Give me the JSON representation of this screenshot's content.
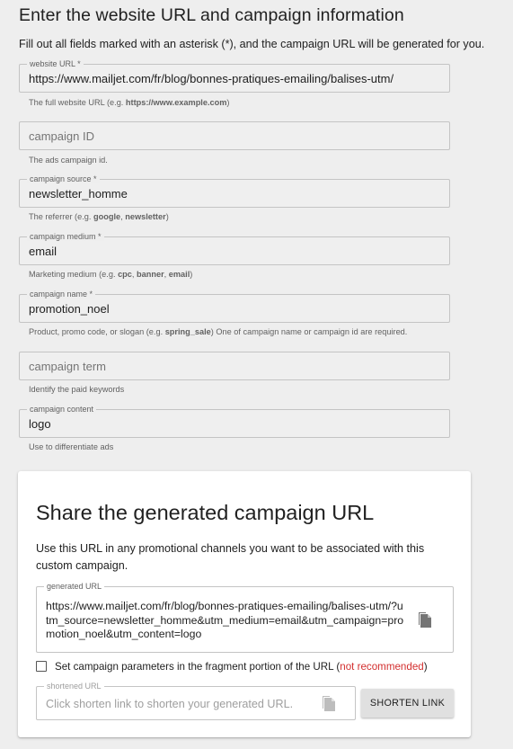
{
  "heading": "Enter the website URL and campaign information",
  "intro": "Fill out all fields marked with an asterisk (*), and the campaign URL will be generated for you.",
  "fields": {
    "website_url": {
      "label": "website URL *",
      "value": "https://www.mailjet.com/fr/blog/bonnes-pratiques-emailing/balises-utm/",
      "helper_pre": "The full website URL (e.g. ",
      "helper_bold": "https://www.example.com",
      "helper_post": ")"
    },
    "campaign_id": {
      "placeholder": "campaign ID",
      "helper": "The ads campaign id."
    },
    "campaign_source": {
      "label": "campaign source *",
      "value": "newsletter_homme",
      "helper_pre": "The referrer (e.g. ",
      "helper_b1": "google",
      "helper_sep": ", ",
      "helper_b2": "newsletter",
      "helper_post": ")"
    },
    "campaign_medium": {
      "label": "campaign medium *",
      "value": "email",
      "helper_pre": "Marketing medium (e.g. ",
      "helper_b1": "cpc",
      "helper_sep1": ", ",
      "helper_b2": "banner",
      "helper_sep2": ", ",
      "helper_b3": "email",
      "helper_post": ")"
    },
    "campaign_name": {
      "label": "campaign name *",
      "value": "promotion_noel",
      "helper_pre": "Product, promo code, or slogan (e.g. ",
      "helper_bold": "spring_sale",
      "helper_post": ") One of campaign name or campaign id are required."
    },
    "campaign_term": {
      "placeholder": "campaign term",
      "helper": "Identify the paid keywords"
    },
    "campaign_content": {
      "label": "campaign content",
      "value": "logo",
      "helper": "Use to differentiate ads"
    }
  },
  "share": {
    "title": "Share the generated campaign URL",
    "description": "Use this URL in any promotional channels you want to be associated with this custom campaign.",
    "generated_label": "generated URL",
    "generated_url": "https://www.mailjet.com/fr/blog/bonnes-pratiques-emailing/balises-utm/?utm_source=newsletter_homme&utm_medium=email&utm_campaign=promotion_noel&utm_content=logo",
    "checkbox_label": "Set campaign parameters in the fragment portion of the URL (",
    "checkbox_warning": "not recommended",
    "checkbox_close": ")",
    "checkbox_checked": false,
    "shortened_label": "shortened URL",
    "shortened_placeholder": "Click shorten link to shorten your generated URL.",
    "shorten_button": "SHORTEN LINK"
  },
  "icons": {
    "copy_generated": "copy-icon",
    "copy_shortened": "copy-icon"
  },
  "colors": {
    "warning": "#d32f2f",
    "background": "#eeeeee",
    "card": "#ffffff",
    "button": "#e0e0e0"
  }
}
